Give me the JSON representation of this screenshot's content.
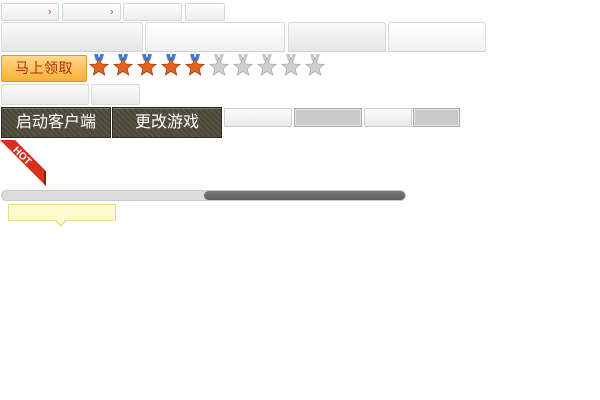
{
  "claim": {
    "label": "马上领取"
  },
  "rating": {
    "value": 5,
    "max": 10
  },
  "client": {
    "start_label": "启动客户端",
    "change_game_label": "更改游戏"
  },
  "hot_badge": {
    "text": "HOT"
  },
  "progress": {
    "value_percent": 50
  },
  "colors": {
    "accent_orange": "#f7b036",
    "hot_red": "#d8301f",
    "dark_button": "#4f4c3e"
  },
  "icons": [
    "chevron-right-icon",
    "star-medal-icon",
    "hot-corner-ribbon"
  ]
}
